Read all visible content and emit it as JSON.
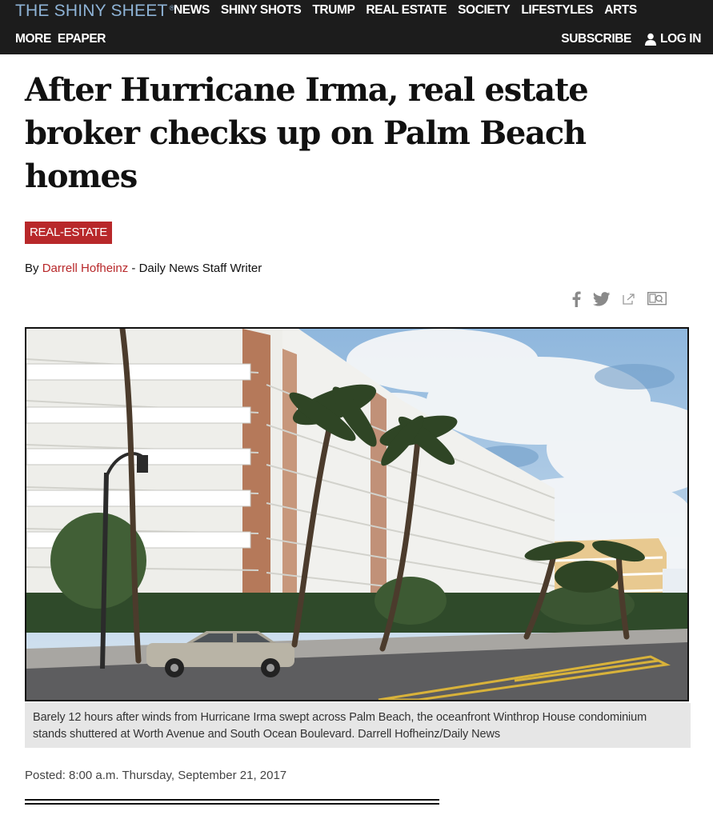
{
  "brand": {
    "name": "THE SHINY SHEET",
    "mark": "®"
  },
  "nav": {
    "row1": [
      "NEWS",
      "SHINY SHOTS",
      "TRUMP",
      "REAL ESTATE",
      "SOCIETY",
      "LIFESTYLES",
      "ARTS"
    ],
    "row2": [
      "MORE",
      "EPAPER"
    ],
    "subscribe": "SUBSCRIBE",
    "login": "LOG IN"
  },
  "article": {
    "headline": "After Hurricane Irma, real estate broker checks up on Palm Beach homes",
    "category": "REAL-ESTATE",
    "byline_prefix": "By ",
    "author": "Darrell Hofheinz",
    "byline_suffix": " - Daily News Staff Writer",
    "caption": "Barely 12 hours after winds from Hurricane Irma swept across Palm Beach, the oceanfront Winthrop House condominium stands shuttered at Worth Avenue and South Ocean Boulevard. Darrell Hofheinz/Daily News",
    "posted": "Posted: 8:00 a.m. Thursday, September 21, 2017"
  },
  "share_icons": [
    "facebook-icon",
    "twitter-icon",
    "share-icon",
    "comments-icon"
  ],
  "colors": {
    "nav_bg": "#1c1c1c",
    "logo": "#8eb3d6",
    "accent": "#b8282a",
    "caption_bg": "#e6e6e6"
  }
}
